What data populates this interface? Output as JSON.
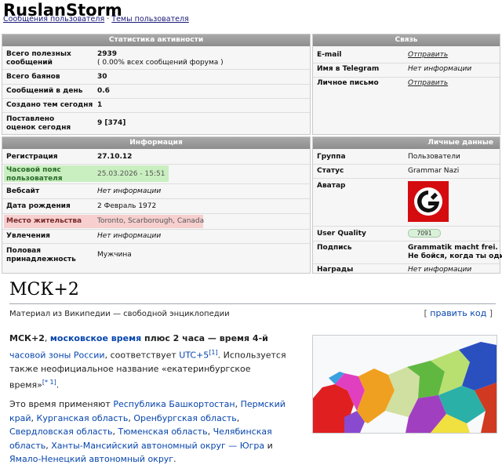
{
  "profile": {
    "username": "RuslanStorm",
    "links": [
      {
        "label": "Сообщения пользователя"
      },
      {
        "label": "Темы пользователя"
      }
    ],
    "link_separator": "·"
  },
  "activity": {
    "header": "Статистика активности",
    "rows": [
      {
        "label": "Всего полезных сообщений",
        "value": "2939",
        "note": "( 0.00% всех сообщений форума )"
      },
      {
        "label": "Всего баянов",
        "value": "30"
      },
      {
        "label": "Сообщений в день",
        "value": "0.6"
      },
      {
        "label": "Создано тем сегодня",
        "value": "1"
      },
      {
        "label": "Поставлено оценок сегодня",
        "value": "9 [374]"
      }
    ]
  },
  "contact": {
    "header": "Связь",
    "rows": [
      {
        "label": "E-mail",
        "value": "Отправить"
      },
      {
        "label": "Имя в Telegram",
        "value": "Нет информации"
      },
      {
        "label": "Личное письмо",
        "value": "Отправить"
      }
    ]
  },
  "info": {
    "header": "Информация",
    "rows": [
      {
        "label": "Регистрация",
        "value": "27.10.12"
      },
      {
        "label": "Часовой пояс пользователя",
        "value": "25.03.2026 - 15:51"
      },
      {
        "label": "Вебсайт",
        "value": "Нет информации"
      },
      {
        "label": "Дата рождения",
        "value": "2 Февраль 1972"
      },
      {
        "label": "Место жительства",
        "value": "Toronto, Scarborough, Canada"
      },
      {
        "label": "Увлечения",
        "value": "Нет информации"
      },
      {
        "label": "Половая принадлежность",
        "value": "Мужчина"
      }
    ]
  },
  "personal": {
    "header": "Личные данные",
    "rows": [
      {
        "label": "Группа",
        "value": "Пользователи"
      },
      {
        "label": "Статус",
        "value": "Grammar Nazi"
      },
      {
        "label": "Аватар",
        "value": ""
      },
      {
        "label": "User Quality",
        "value": "7091"
      },
      {
        "label": "Подпись",
        "value": "Grammatik macht frei.",
        "value2": "Не бойся, когда ты один. Бо"
      },
      {
        "label": "Награды",
        "value": "Нет информации"
      }
    ]
  },
  "wiki": {
    "title": "МСК+2",
    "subtitle": "Материал из Википедии — свободной энциклопедии",
    "edit": "править код",
    "p1": {
      "b1": "МСК+2",
      "t1": ", ",
      "l1": "московское время",
      "t2": " плюс 2 часа — время 4-й ",
      "l2": "часовой зоны России",
      "t3": ", соответствует ",
      "l3": "UTC+5",
      "s1": "[1]",
      "t4": ". Используется также неофициальное название «екатеринбургское время»",
      "s2": "[* 1]",
      "t5": "."
    },
    "p2": {
      "t1": "Это время применяют ",
      "l1": "Республика Башкортостан",
      "c1": ", ",
      "l2": "Пермский край",
      "c2": ", ",
      "l3": "Курганская область",
      "c3": ", ",
      "l4": "Оренбургская область",
      "c4": ", ",
      "l5": "Свердловская область",
      "c5": ", ",
      "l6": "Тюменская область",
      "c6": ", ",
      "l7": "Челябинская область",
      "c7": ", ",
      "l8": "Ханты-Мансийский автономный округ — Югра",
      "c8": " и ",
      "l9": "Ямало-Ненецкий автономный округ",
      "t2": "."
    }
  },
  "colors": {
    "header_gray": "#999999",
    "highlight_green": "#c9efc0",
    "highlight_red": "#f7cfcf",
    "wiki_link": "#0645ad",
    "avatar_red": "#d40c10"
  },
  "icons": [
    "grammar-nazi-avatar-icon",
    "russia-timezone-map"
  ]
}
